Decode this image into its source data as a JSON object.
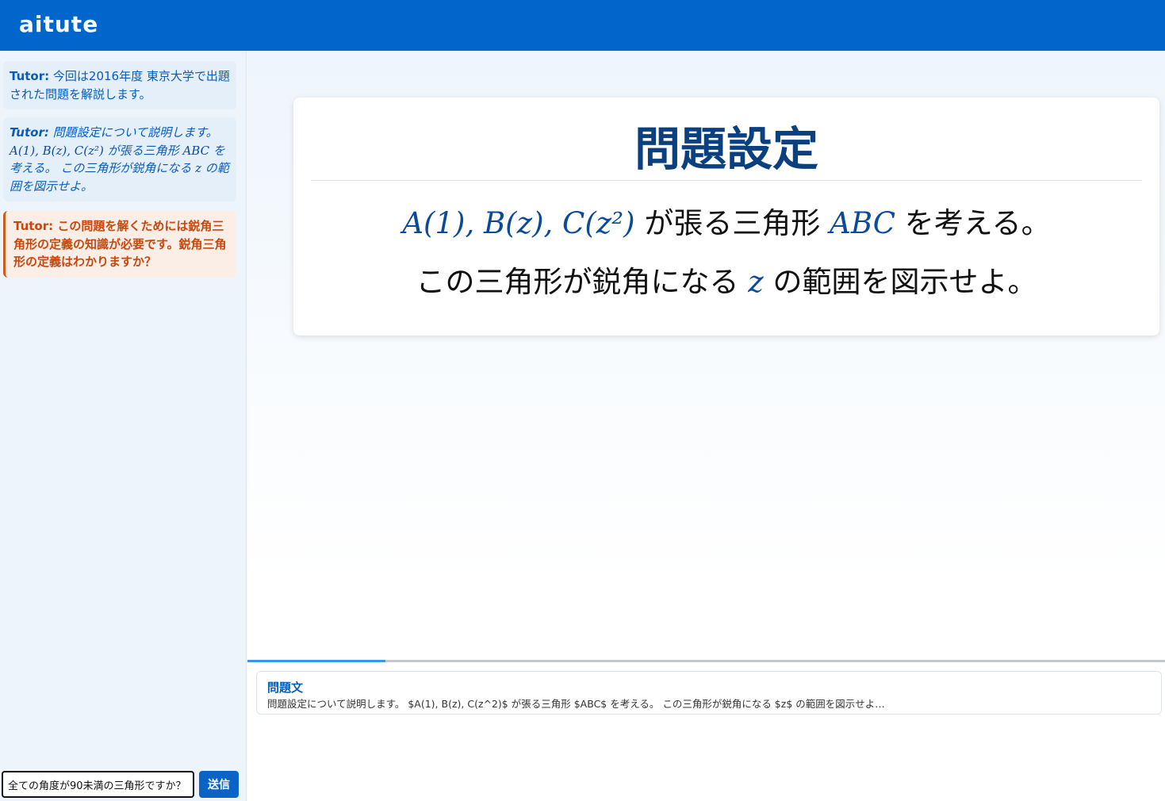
{
  "app": {
    "title": "aitute"
  },
  "sidebar": {
    "messages": [
      {
        "speaker": "Tutor:",
        "text": " 今回は2016年度 東京大学で出題された問題を解説します。"
      },
      {
        "speaker": "Tutor:",
        "text_a": " 問題設定について説明します。",
        "math_a": "A(1), B(z), C(z²)",
        "text_b": " が張る三角形 ",
        "math_b": "ABC",
        "text_c": " を考える。 この三角形が鋭角になる ",
        "math_c": "z",
        "text_d": " の範囲を図示せよ。"
      },
      {
        "speaker": "Tutor:",
        "text": " この問題を解くためには鋭角三角形の定義の知識が必要です。鋭角三角形の定義はわかりますか？"
      }
    ],
    "input": {
      "value": "全ての角度が90未満の三角形ですか？"
    },
    "send_label": "送信"
  },
  "slide": {
    "title": "問題設定",
    "line1": {
      "math_a": "A(1), B(z), C(z²)",
      "text_a": " が張る三角形 ",
      "math_b": "ABC",
      "text_b": " を考える。"
    },
    "line2": {
      "text_a": "この三角形が鋭角になる ",
      "math_a": "z",
      "text_b": " の範囲を図示せよ。"
    }
  },
  "progress": {
    "value": 0.15
  },
  "info_card": {
    "title": "問題文",
    "text": "問題設定について説明します。 $A(1), B(z), C(z^2)$ が張る三角形 $ABC$ を考える。 この三角形が鋭角になる $z$ の範囲を図示せよ…"
  },
  "colors": {
    "header": "#0066cc",
    "tutor_text": "#0b5cb8",
    "highlight_text": "#c9470d",
    "slide_title": "#0a3f80",
    "progress": "#3a96e6"
  }
}
